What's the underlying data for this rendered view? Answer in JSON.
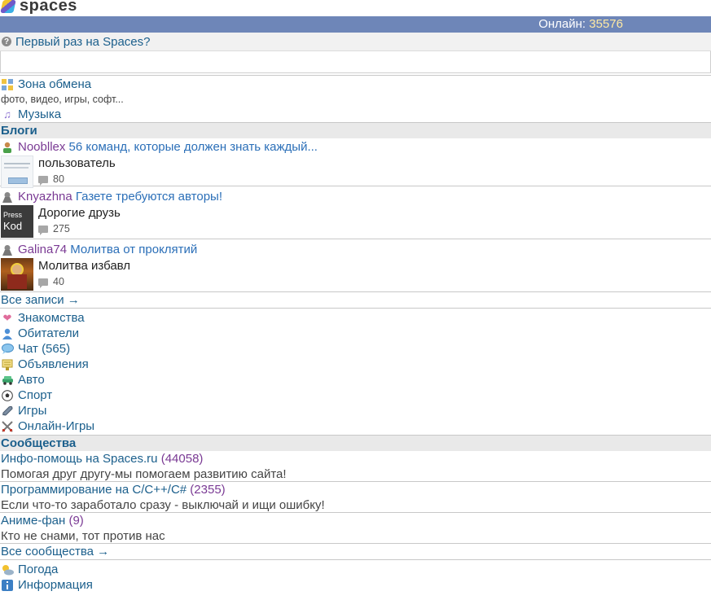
{
  "header": {
    "logo_text": "spaces",
    "online_label": "Онлайн:",
    "online_count": "35576"
  },
  "first_time": {
    "icon": "question-icon",
    "label": "Первый раз на Spaces?"
  },
  "exchange": {
    "label": "Зона обмена",
    "subtitle": "фото, видео, игры, софт..."
  },
  "music": {
    "label": "Музыка"
  },
  "blogs": {
    "heading": "Блоги",
    "items": [
      {
        "author": "Nooblleх",
        "title": "56 команд, которые должен знать каждый...",
        "snippet": "пользователь",
        "comments": "80"
      },
      {
        "author": "Knyazhna",
        "title": "Газете требуются авторы!",
        "snippet": "Дорогие друзь",
        "comments": "275",
        "thumb_line1": "Press",
        "thumb_line2": "Kod"
      },
      {
        "author": "Galina74",
        "title": "Молитва от проклятий",
        "snippet": "Молитва избавл",
        "comments": "40"
      }
    ],
    "all_link": "Все записи →"
  },
  "menu": [
    {
      "label": "Знакомства",
      "icon": "heart-icon"
    },
    {
      "label": "Обитатели",
      "icon": "person-icon"
    },
    {
      "label": "Чат",
      "count": "(565)",
      "icon": "chat-icon"
    },
    {
      "label": "Объявления",
      "icon": "board-icon"
    },
    {
      "label": "Авто",
      "icon": "car-icon"
    },
    {
      "label": "Спорт",
      "icon": "ball-icon"
    },
    {
      "label": "Игры",
      "icon": "gamepad-icon"
    },
    {
      "label": "Онлайн-Игры",
      "icon": "swords-icon"
    }
  ],
  "communities": {
    "heading": "Сообщества",
    "items": [
      {
        "name": "Инфо-помощь на Spaces.ru",
        "count": "(44058)",
        "desc": "Помогая друг другу-мы помогаем развитию сайта!"
      },
      {
        "name": "Программирование на C/C++/C#",
        "count": "(2355)",
        "desc": "Если что-то заработало сразу - выключай и ищи ошибку!"
      },
      {
        "name": "Аниме-фан",
        "count": "(9)",
        "desc": "Кто не снами, тот против нас"
      }
    ],
    "all_link": "Все сообщества →"
  },
  "footer_menu": [
    {
      "label": "Погода",
      "icon": "weather-icon"
    },
    {
      "label": "Информация",
      "icon": "info-icon"
    }
  ]
}
